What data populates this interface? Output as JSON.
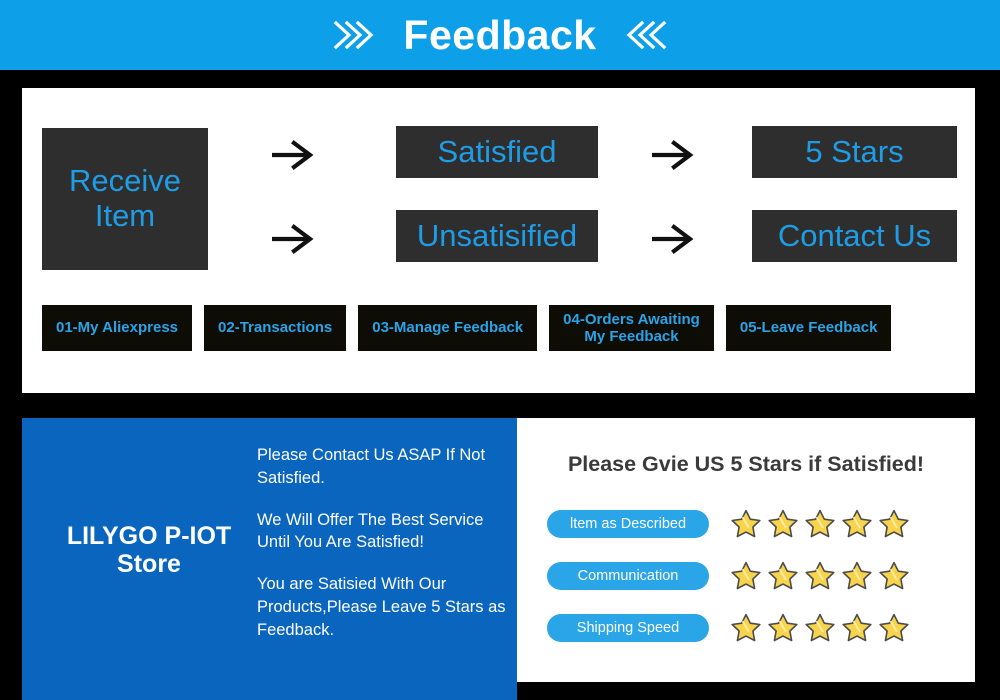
{
  "banner": {
    "title": "Feedback",
    "left_icon": "double-chevron-right-icon",
    "right_icon": "double-chevron-left-icon",
    "background_color": "#0d9fe8"
  },
  "flow": {
    "receive": "Receive\nItem",
    "receive_line1": "Receive",
    "receive_line2": "Item",
    "satisfied": "Satisfied",
    "unsatisfied": "Unsatisified",
    "five_stars": "5 Stars",
    "contact_us": "Contact Us",
    "arrow_glyph": "→",
    "box_color": "#2e2e2e",
    "text_color": "#1f9ce6"
  },
  "steps": [
    {
      "label": "01-My Aliexpress",
      "line1": "01-My Aliexpress",
      "line2": ""
    },
    {
      "label": "02-Transactions",
      "line1": "02-Transactions",
      "line2": ""
    },
    {
      "label": "03-Manage Feedback",
      "line1": "03-Manage Feedback",
      "line2": ""
    },
    {
      "label": "04-Orders Awaiting My Feedback",
      "line1": "04-Orders Awaiting",
      "line2": "My Feedback"
    },
    {
      "label": "05-Leave Feedback",
      "line1": "05-Leave Feedback",
      "line2": ""
    }
  ],
  "store": {
    "name_line1": "LILYGO P-IOT",
    "name_line2": "Store",
    "paragraphs": [
      "Please Contact Us ASAP If Not Satisfied.",
      "We Will Offer The Best Service Until You Are Satisfied!",
      "You are Satisied With Our Products,Please Leave 5 Stars as Feedback."
    ],
    "background_color": "#0965bd"
  },
  "ratings": {
    "title": "Please Gvie US 5 Stars if Satisfied!",
    "pill_color": "#29a5e8",
    "star_color": "#f7d44c",
    "rows": [
      {
        "label": "ltem as Described",
        "stars": 5
      },
      {
        "label": "Communication",
        "stars": 5
      },
      {
        "label": "Shipping Speed",
        "stars": 5
      }
    ]
  }
}
